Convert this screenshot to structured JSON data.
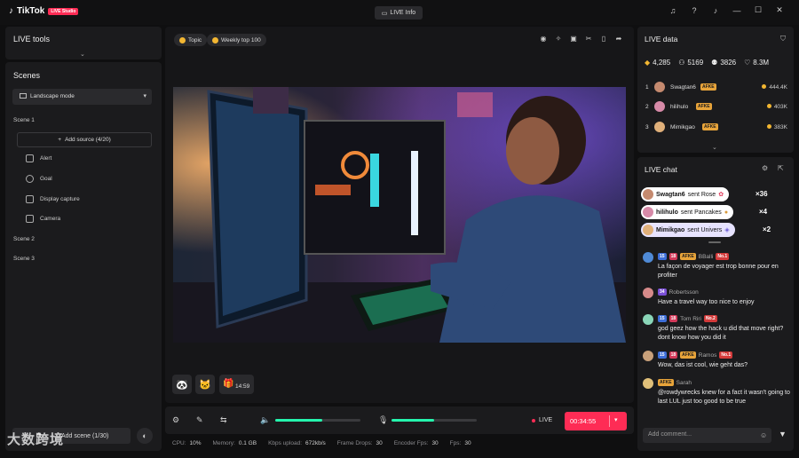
{
  "app": {
    "name": "TikTok",
    "badge": "LIVE Studio"
  },
  "titlebar": {
    "live_info": "LIVE Info"
  },
  "live_tools": {
    "title": "LIVE tools"
  },
  "scenes": {
    "title": "Scenes",
    "mode": "Landscape mode",
    "scene1": "Scene 1",
    "add_source": "Add source (4/20)",
    "sources": [
      "Alert",
      "Goal",
      "Display capture",
      "Camera"
    ],
    "scene2": "Scene 2",
    "scene3": "Scene 3",
    "add_scene": "Add scene (1/30)"
  },
  "preview": {
    "topic": "Topic",
    "weekly": "Weekly top 100",
    "timer_gift": "14:59"
  },
  "controls": {
    "mic_level": 0.55,
    "speaker_level": 0.5,
    "live_label": "LIVE",
    "elapsed": "00:34:55"
  },
  "stats": [
    {
      "label": "CPU:",
      "value": "10%"
    },
    {
      "label": "Memory:",
      "value": "0.1 GB"
    },
    {
      "label": "Kbps upload:",
      "value": "672kb/s"
    },
    {
      "label": "Frame Drops:",
      "value": "30"
    },
    {
      "label": "Encoder Fps:",
      "value": "30"
    },
    {
      "label": "Fps:",
      "value": "30"
    }
  ],
  "live_data": {
    "title": "LIVE data",
    "metrics": [
      "4,285",
      "5169",
      "3826",
      "8.3M"
    ],
    "ranking": [
      {
        "rank": "1",
        "name": "Swagtan6",
        "badge": "AFKE",
        "score": "444.4K"
      },
      {
        "rank": "2",
        "name": "hilihulo",
        "badge": "AFKE",
        "score": "403K"
      },
      {
        "rank": "3",
        "name": "Mimikgao",
        "badge": "AFKE",
        "score": "383K"
      }
    ]
  },
  "live_chat": {
    "title": "LIVE chat",
    "gifts": [
      {
        "user": "Swagtan6",
        "action": "sent Rose",
        "count": "×36"
      },
      {
        "user": "hilihulo",
        "action": "sent Pancakes",
        "count": "×4"
      },
      {
        "user": "Mimikgao",
        "action": "sent Univers",
        "count": "×2"
      }
    ],
    "messages": [
      {
        "lvl": "15",
        "heart": "18",
        "afk": "AFKE",
        "name": "BBalli",
        "no": "No.1",
        "text": "La façon de voyager est trop bonne pour en profiter"
      },
      {
        "lvl": "34",
        "name": "Robertsson",
        "text": "Have a travel way too nice to enjoy"
      },
      {
        "lvl": "15",
        "heart": "18",
        "name": "Tom Riri",
        "no": "No.2",
        "text": "god geez how the hack u did that move right? dont know how you did it"
      },
      {
        "lvl": "15",
        "heart": "18",
        "afk": "AFKE",
        "name": "Ramos",
        "no": "No.1",
        "text": "Wow, das ist cool, wie geht das?"
      },
      {
        "afk": "AFKE",
        "name": "Sarah",
        "text": "@rowdywrecks knew for a fact it wasn't going to last LUL just too good to be true"
      }
    ],
    "comment_placeholder": "Add comment..."
  },
  "watermark": "大数跨境",
  "colors": {
    "accent": "#fe2c55",
    "teal": "#25f4ad",
    "gold": "#f2b632"
  }
}
